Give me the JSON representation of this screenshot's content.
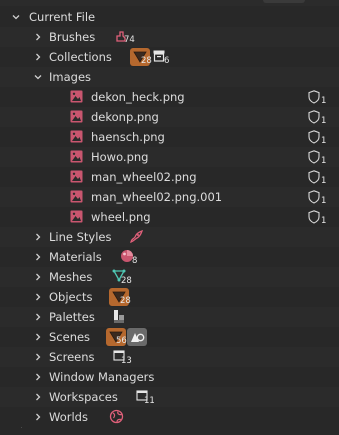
{
  "root": {
    "label": "Current File",
    "expanded": true
  },
  "categories": [
    {
      "key": "brushes",
      "label": "Brushes",
      "count": "74"
    },
    {
      "key": "collections",
      "label": "Collections",
      "count": "28",
      "count2": "6"
    },
    {
      "key": "images",
      "label": "Images",
      "expanded": true
    },
    {
      "key": "line_styles",
      "label": "Line Styles"
    },
    {
      "key": "materials",
      "label": "Materials",
      "count": "8"
    },
    {
      "key": "meshes",
      "label": "Meshes",
      "count": "28"
    },
    {
      "key": "objects",
      "label": "Objects",
      "count": "28"
    },
    {
      "key": "palettes",
      "label": "Palettes"
    },
    {
      "key": "scenes",
      "label": "Scenes",
      "count": "56"
    },
    {
      "key": "screens",
      "label": "Screens",
      "count": "13"
    },
    {
      "key": "window_managers",
      "label": "Window Managers"
    },
    {
      "key": "workspaces",
      "label": "Workspaces",
      "count": "11"
    },
    {
      "key": "worlds",
      "label": "Worlds"
    }
  ],
  "images": [
    {
      "name": "dekon_heck.png",
      "users": "1"
    },
    {
      "name": "dekonp.png",
      "users": "1"
    },
    {
      "name": "haensch.png",
      "users": "1"
    },
    {
      "name": "Howo.png",
      "users": "1"
    },
    {
      "name": "man_wheel02.png",
      "users": "1"
    },
    {
      "name": "man_wheel02.png.001",
      "users": "1"
    },
    {
      "name": "wheel.png",
      "users": "1"
    }
  ],
  "icons": {
    "image": "image-icon",
    "shield": "fake-user-shield-icon",
    "brush": "brush-icon",
    "collection": "collection-icon",
    "line_style": "line-style-icon",
    "material": "material-icon",
    "mesh": "mesh-icon",
    "object": "object-icon",
    "palette": "palette-icon",
    "scene": "scene-icon",
    "screen": "screen-icon",
    "workspace": "workspace-icon",
    "world": "world-icon"
  },
  "colors": {
    "background": "#282828",
    "row_alt": "#2b2b2b",
    "text": "#dcdcdc",
    "orange_badge": "#b5682e",
    "image_pink": "#d35a74",
    "red_icon": "#e0607a"
  }
}
